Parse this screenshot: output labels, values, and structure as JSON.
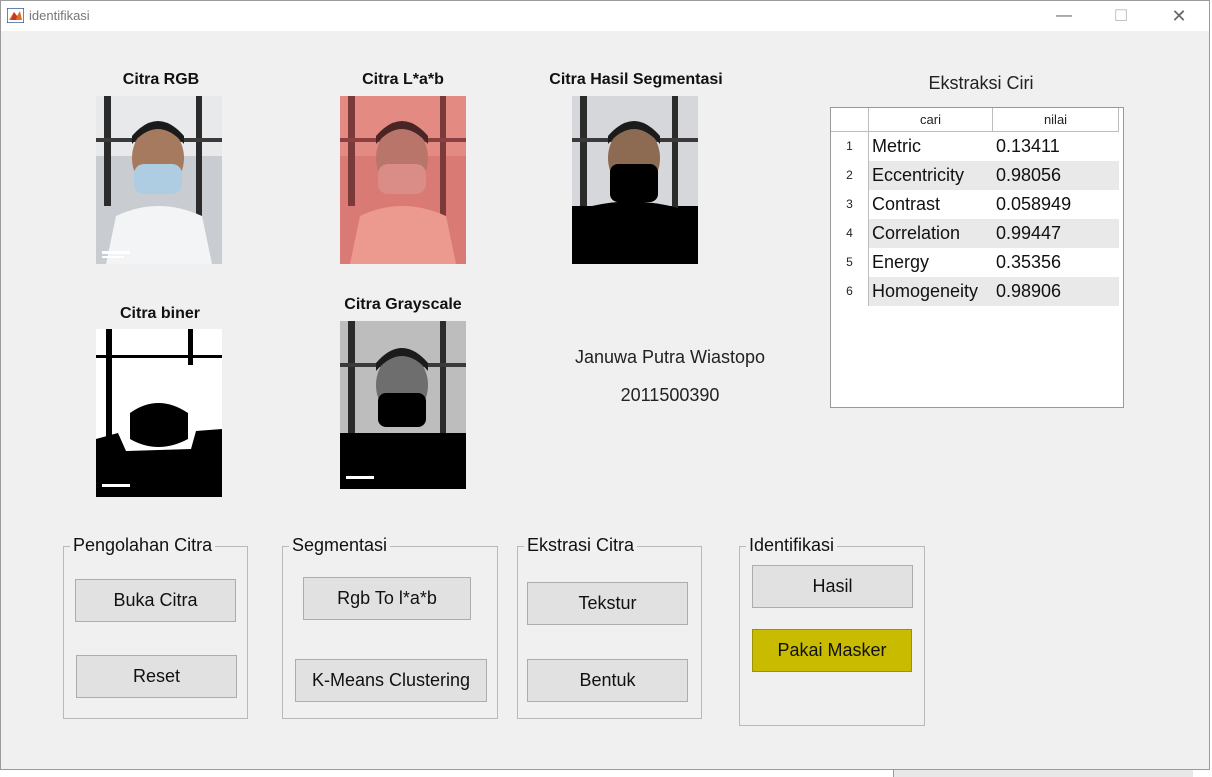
{
  "window": {
    "title": "identifikasi",
    "controls": {
      "minimize": "—",
      "maximize": "☐",
      "close": "✕"
    }
  },
  "images": {
    "rgb": {
      "title": "Citra RGB"
    },
    "lab": {
      "title": "Citra L*a*b"
    },
    "segmentasi": {
      "title": "Citra Hasil Segmentasi"
    },
    "biner": {
      "title": "Citra biner"
    },
    "grayscale": {
      "title": "Citra Grayscale"
    }
  },
  "ekstraksi": {
    "title": "Ekstraksi Ciri",
    "columns": [
      "cari",
      "nilai"
    ],
    "rows": [
      {
        "num": "1",
        "cari": "Metric",
        "nilai": "0.13411"
      },
      {
        "num": "2",
        "cari": "Eccentricity",
        "nilai": "0.98056"
      },
      {
        "num": "3",
        "cari": "Contrast",
        "nilai": "0.058949"
      },
      {
        "num": "4",
        "cari": "Correlation",
        "nilai": "0.99447"
      },
      {
        "num": "5",
        "cari": "Energy",
        "nilai": "0.35356"
      },
      {
        "num": "6",
        "cari": "Homogeneity",
        "nilai": "0.98906"
      }
    ]
  },
  "identity": {
    "name": "Januwa Putra Wiastopo",
    "nim": "2011500390"
  },
  "panels": {
    "pengolahan": {
      "title": "Pengolahan Citra",
      "buka": "Buka Citra",
      "reset": "Reset"
    },
    "segmentasi": {
      "title": "Segmentasi",
      "rgb_to_lab": "Rgb To  l*a*b",
      "kmeans": "K-Means Clustering"
    },
    "ekstrasi": {
      "title": "Ekstrasi Citra",
      "tekstur": "Tekstur",
      "bentuk": "Bentuk"
    },
    "identifikasi": {
      "title": "Identifikasi",
      "hasil": "Hasil",
      "pakai_masker": "Pakai Masker"
    }
  },
  "colors": {
    "window_bg": "#f0f0f0",
    "highlight_button": "#c8bb00",
    "stripe_row": "#e9e9e9"
  }
}
